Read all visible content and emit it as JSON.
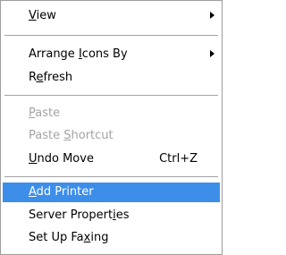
{
  "menu": {
    "items": [
      {
        "label": "View",
        "mnemonic_index": 0,
        "submenu": true,
        "enabled": true
      },
      {
        "label": "Arrange Icons By",
        "mnemonic_index": 8,
        "submenu": true,
        "enabled": true
      },
      {
        "label": "Refresh",
        "mnemonic_index": 1,
        "submenu": false,
        "enabled": true
      },
      {
        "label": "Paste",
        "mnemonic_index": 0,
        "submenu": false,
        "enabled": false
      },
      {
        "label": "Paste Shortcut",
        "mnemonic_index": 6,
        "submenu": false,
        "enabled": false
      },
      {
        "label": "Undo Move",
        "mnemonic_index": 0,
        "submenu": false,
        "enabled": true,
        "shortcut": "Ctrl+Z"
      },
      {
        "label": "Add Printer",
        "mnemonic_index": 0,
        "submenu": false,
        "enabled": true,
        "highlighted": true
      },
      {
        "label": "Server Properties",
        "mnemonic_index": 14,
        "submenu": false,
        "enabled": true
      },
      {
        "label": "Set Up Faxing",
        "mnemonic_index": 9,
        "submenu": false,
        "enabled": true
      }
    ]
  },
  "colors": {
    "highlight": "#3d8ee9",
    "disabled_text": "#a3a3a3",
    "border": "#9d9d9d"
  }
}
